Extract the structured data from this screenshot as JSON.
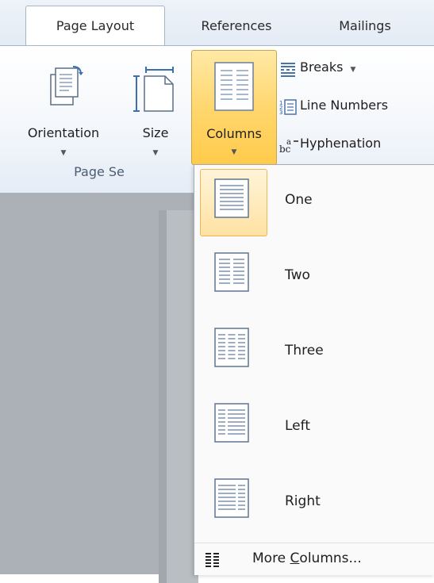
{
  "tabs": [
    {
      "label": "Page Layout",
      "active": true
    },
    {
      "label": "References",
      "active": false
    },
    {
      "label": "Mailings",
      "active": false
    }
  ],
  "ribbon": {
    "orientation_label": "Orientation",
    "size_label": "Size",
    "columns_label": "Columns",
    "breaks_label": "Breaks",
    "line_numbers_label": "Line Numbers",
    "hyphenation_label": "Hyphenation",
    "group_label": "Page Se"
  },
  "menu": {
    "items": [
      {
        "label": "One",
        "selected": true
      },
      {
        "label": "Two",
        "selected": false
      },
      {
        "label": "Three",
        "selected": false
      },
      {
        "label": "Left",
        "selected": false
      },
      {
        "label": "Right",
        "selected": false
      }
    ],
    "more_prefix": "More ",
    "more_accel": "C",
    "more_suffix": "olumns..."
  },
  "colors": {
    "accent_highlight": "#ffd56a",
    "menu_selection": "#ffe2a3",
    "document_bg": "#abb1b7"
  }
}
